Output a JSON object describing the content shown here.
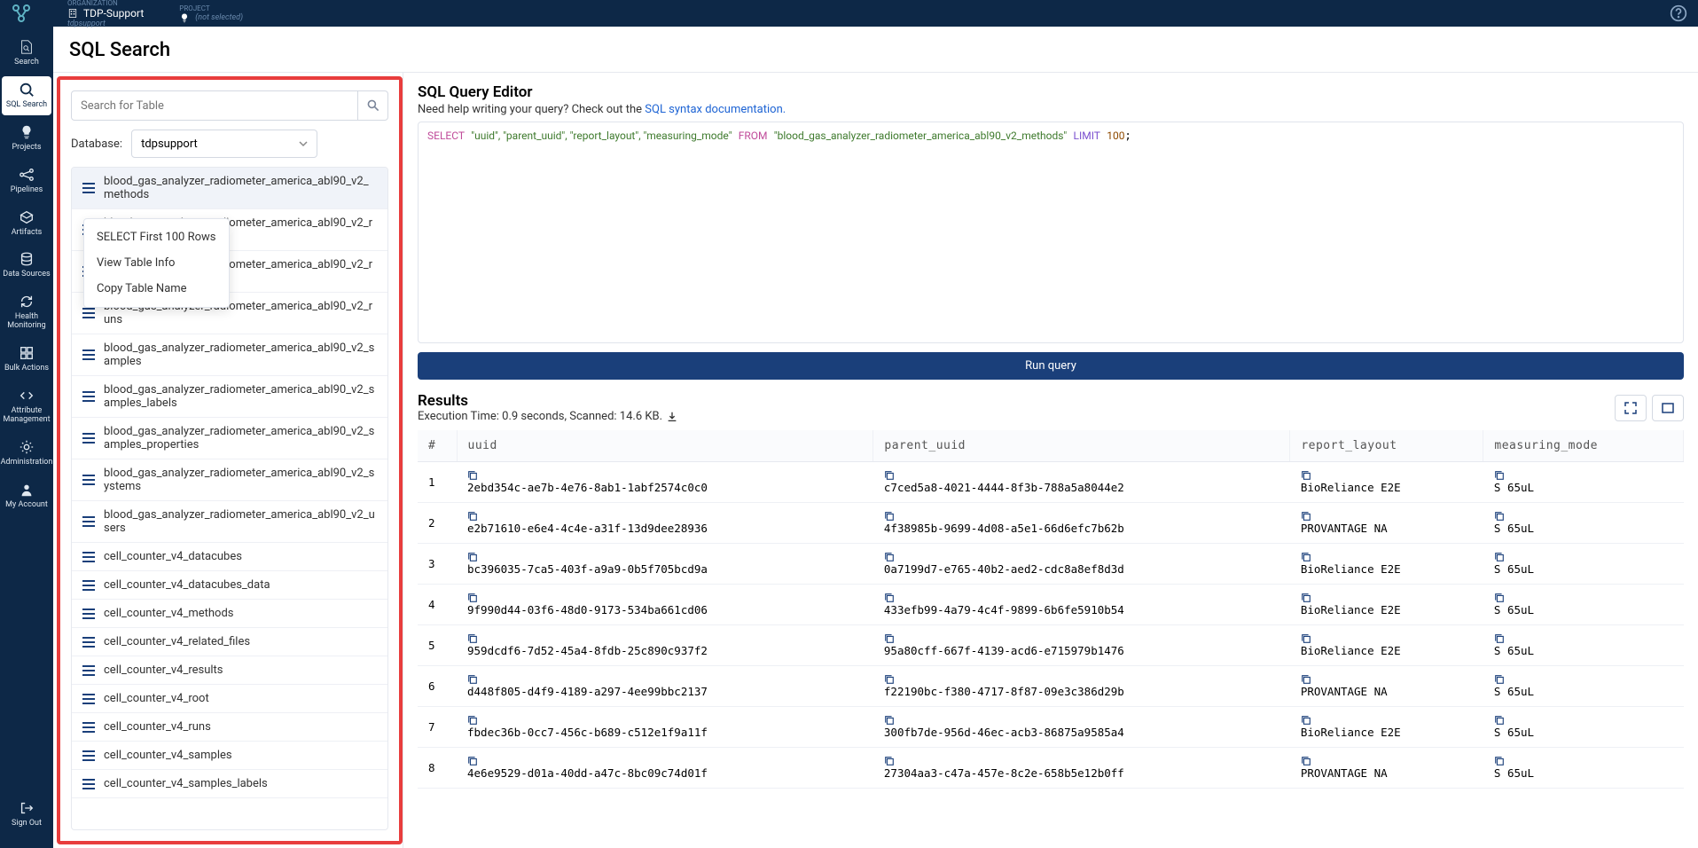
{
  "topbar": {
    "org_label": "ORGANIZATION",
    "org_name": "TDP-Support",
    "org_slug": "tdpsupport",
    "project_label": "PROJECT",
    "project_value": "(not selected)"
  },
  "sidebar": {
    "items": [
      {
        "label": "Search",
        "name": "search"
      },
      {
        "label": "SQL Search",
        "name": "sql-search"
      },
      {
        "label": "Projects",
        "name": "projects"
      },
      {
        "label": "Pipelines",
        "name": "pipelines"
      },
      {
        "label": "Artifacts",
        "name": "artifacts"
      },
      {
        "label": "Data Sources",
        "name": "data-sources"
      },
      {
        "label": "Health Monitoring",
        "name": "health"
      },
      {
        "label": "Bulk Actions",
        "name": "bulk"
      },
      {
        "label": "Attribute Management",
        "name": "attribute"
      },
      {
        "label": "Administration",
        "name": "admin"
      },
      {
        "label": "My Account",
        "name": "account"
      }
    ],
    "signout": "Sign Out"
  },
  "page_title": "SQL Search",
  "table_panel": {
    "search_placeholder": "Search for Table",
    "database_label": "Database:",
    "database_value": "tdpsupport",
    "context_menu": [
      "SELECT First 100 Rows",
      "View Table Info",
      "Copy Table Name"
    ],
    "tables": [
      "blood_gas_analyzer_radiometer_america_abl90_v2_methods",
      "blood_gas_analyzer_radiometer_america_abl90_v2_results",
      "blood_gas_analyzer_radiometer_america_abl90_v2_root",
      "blood_gas_analyzer_radiometer_america_abl90_v2_runs",
      "blood_gas_analyzer_radiometer_america_abl90_v2_samples",
      "blood_gas_analyzer_radiometer_america_abl90_v2_samples_labels",
      "blood_gas_analyzer_radiometer_america_abl90_v2_samples_properties",
      "blood_gas_analyzer_radiometer_america_abl90_v2_systems",
      "blood_gas_analyzer_radiometer_america_abl90_v2_users",
      "cell_counter_v4_datacubes",
      "cell_counter_v4_datacubes_data",
      "cell_counter_v4_methods",
      "cell_counter_v4_related_files",
      "cell_counter_v4_results",
      "cell_counter_v4_root",
      "cell_counter_v4_runs",
      "cell_counter_v4_samples",
      "cell_counter_v4_samples_labels"
    ]
  },
  "editor": {
    "title": "SQL Query Editor",
    "help_text": "Need help writing your query? Check out the ",
    "help_link": "SQL syntax documentation.",
    "query": {
      "select": "SELECT",
      "cols": "\"uuid\", \"parent_uuid\", \"report_layout\", \"measuring_mode\"",
      "from": "FROM",
      "table": "\"blood_gas_analyzer_radiometer_america_abl90_v2_methods\"",
      "limit": "LIMIT",
      "num": "100"
    },
    "run_button": "Run query"
  },
  "results": {
    "title": "Results",
    "exec_time": "Execution Time: 0.9 seconds, Scanned: 14.6 KB.",
    "columns": [
      "#",
      "uuid",
      "parent_uuid",
      "report_layout",
      "measuring_mode"
    ],
    "rows": [
      {
        "n": "1",
        "uuid": "2ebd354c-ae7b-4e76-8ab1-1abf2574c0c0",
        "parent_uuid": "c7ced5a8-4021-4444-8f3b-788a5a8044e2",
        "report_layout": "BioReliance E2E",
        "measuring_mode": "S 65uL"
      },
      {
        "n": "2",
        "uuid": "e2b71610-e6e4-4c4e-a31f-13d9dee28936",
        "parent_uuid": "4f38985b-9699-4d08-a5e1-66d6efc7b62b",
        "report_layout": "PROVANTAGE NA",
        "measuring_mode": "S 65uL"
      },
      {
        "n": "3",
        "uuid": "bc396035-7ca5-403f-a9a9-0b5f705bcd9a",
        "parent_uuid": "0a7199d7-e765-40b2-aed2-cdc8a8ef8d3d",
        "report_layout": "BioReliance E2E",
        "measuring_mode": "S 65uL"
      },
      {
        "n": "4",
        "uuid": "9f990d44-03f6-48d0-9173-534ba661cd06",
        "parent_uuid": "433efb99-4a79-4c4f-9899-6b6fe5910b54",
        "report_layout": "BioReliance E2E",
        "measuring_mode": "S 65uL"
      },
      {
        "n": "5",
        "uuid": "959dcdf6-7d52-45a4-8fdb-25c890c937f2",
        "parent_uuid": "95a80cff-667f-4139-acd6-e715979b1476",
        "report_layout": "BioReliance E2E",
        "measuring_mode": "S 65uL"
      },
      {
        "n": "6",
        "uuid": "d448f805-d4f9-4189-a297-4ee99bbc2137",
        "parent_uuid": "f22190bc-f380-4717-8f87-09e3c386d29b",
        "report_layout": "PROVANTAGE NA",
        "measuring_mode": "S 65uL"
      },
      {
        "n": "7",
        "uuid": "fbdec36b-0cc7-456c-b689-c512e1f9a11f",
        "parent_uuid": "300fb7de-956d-46ec-acb3-86875a9585a4",
        "report_layout": "BioReliance E2E",
        "measuring_mode": "S 65uL"
      },
      {
        "n": "8",
        "uuid": "4e6e9529-d01a-40dd-a47c-8bc09c74d01f",
        "parent_uuid": "27304aa3-c47a-457e-8c2e-658b5e12b0ff",
        "report_layout": "PROVANTAGE NA",
        "measuring_mode": "S 65uL"
      }
    ]
  }
}
